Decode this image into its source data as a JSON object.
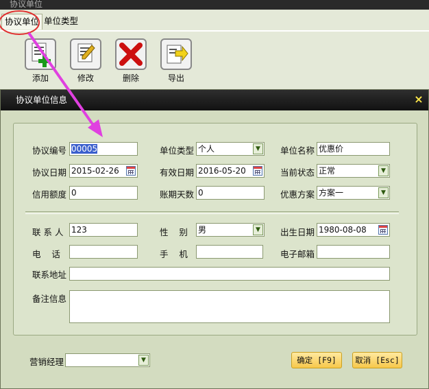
{
  "window": {
    "title": "协议单位"
  },
  "tabs": [
    {
      "label": "协议单位",
      "active": true
    },
    {
      "label": "单位类型",
      "active": false
    }
  ],
  "toolbar": {
    "add_label": "添加",
    "edit_label": "修改",
    "delete_label": "删除",
    "export_label": "导出"
  },
  "dialog": {
    "title": "协议单位信息",
    "close_glyph": "×",
    "fields": {
      "agreement_no": {
        "label": "协议编号",
        "value": "00005"
      },
      "unit_type": {
        "label": "单位类型",
        "value": "个人"
      },
      "unit_name": {
        "label": "单位名称",
        "value": "优惠价"
      },
      "agreement_date": {
        "label": "协议日期",
        "value": "2015-02-26"
      },
      "valid_date": {
        "label": "有效日期",
        "value": "2016-05-20"
      },
      "status": {
        "label": "当前状态",
        "value": "正常"
      },
      "credit": {
        "label": "信用额度",
        "value": "0"
      },
      "billing_days": {
        "label": "账期天数",
        "value": "0"
      },
      "discount_plan": {
        "label": "优惠方案",
        "value": "方案一"
      },
      "contact": {
        "label": "联 系 人",
        "value": "123"
      },
      "gender": {
        "label": "性    别",
        "value": "男"
      },
      "birthday": {
        "label": "出生日期",
        "value": "1980-08-08"
      },
      "phone": {
        "label": "电    话",
        "value": ""
      },
      "mobile": {
        "label": "手    机",
        "value": ""
      },
      "email": {
        "label": "电子邮箱",
        "value": ""
      },
      "address": {
        "label": "联系地址",
        "value": ""
      },
      "remarks": {
        "label": "备注信息",
        "value": ""
      },
      "sales_manager": {
        "label": "营销经理",
        "value": ""
      }
    },
    "buttons": {
      "confirm": "确定 [F9]",
      "cancel": "取消 [Esc]"
    }
  },
  "colors": {
    "annotation_arrow": "#e040e0",
    "annotation_circle": "#e03030",
    "button_bg": "#f7c84a",
    "panel_bg": "#d3dcc0",
    "header_bg": "#1a1a1a"
  }
}
